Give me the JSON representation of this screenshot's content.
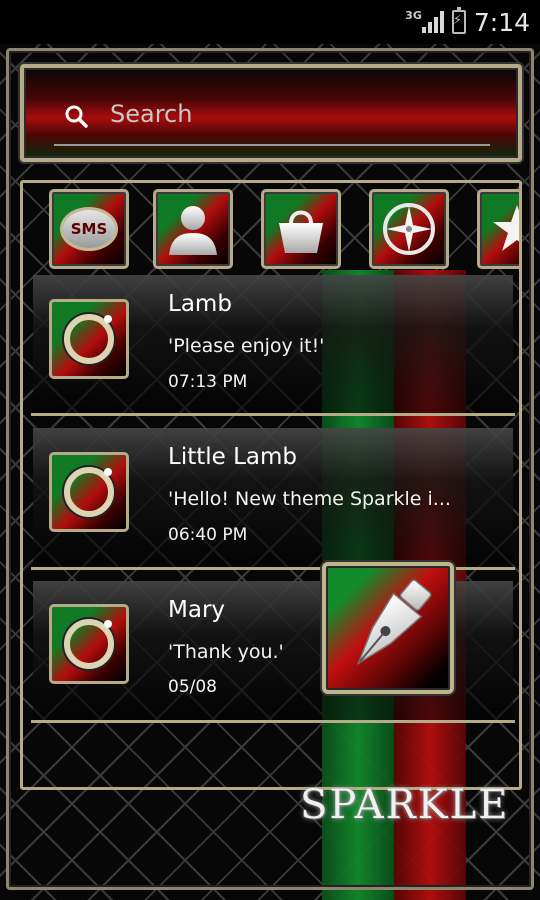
{
  "status_bar": {
    "network": "3G",
    "time": "7:14",
    "icons": [
      "signal-icon",
      "battery-charging-icon"
    ]
  },
  "search": {
    "placeholder": "Search",
    "icon": "search-icon"
  },
  "shortcuts": [
    {
      "name": "sms",
      "label": "SMS",
      "icon": "sms-bubble-icon"
    },
    {
      "name": "contacts",
      "icon": "person-icon"
    },
    {
      "name": "shopping",
      "icon": "shopping-bag-icon"
    },
    {
      "name": "compass",
      "icon": "compass-icon"
    },
    {
      "name": "favorites",
      "icon": "star-icon"
    }
  ],
  "conversations": [
    {
      "name": "Lamb",
      "preview": "'Please enjoy it!'",
      "time": "07:13 PM"
    },
    {
      "name": "Little Lamb",
      "preview": "'Hello! New theme Sparkle i...",
      "time": "06:40 PM"
    },
    {
      "name": "Mary",
      "preview": "'Thank you.'",
      "time": "05/08"
    }
  ],
  "compose": {
    "icon": "pen-nib-icon"
  },
  "brand": {
    "text": "SPARKLE"
  },
  "theme_colors": {
    "gold": "#b5ab88",
    "green": "#128a2c",
    "red": "#b50e0e",
    "background": "#070707"
  }
}
